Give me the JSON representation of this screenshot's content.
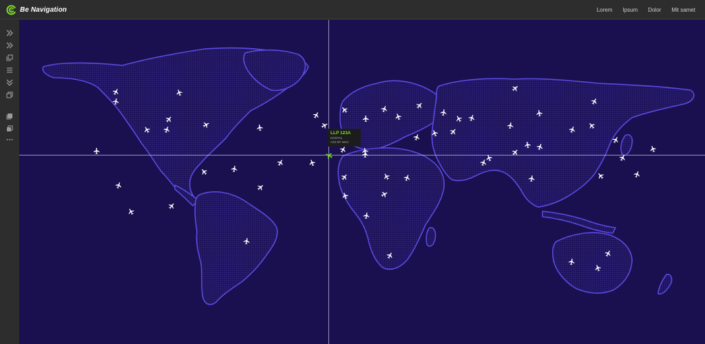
{
  "header": {
    "brand": "Be Navigation",
    "nav": [
      "Lorem",
      "Ipsum",
      "Dolor",
      "Mit samet"
    ]
  },
  "sidebar": {
    "icons": [
      "chevrons-right-icon",
      "chevrons-right-icon",
      "layers-icon",
      "menu-icon",
      "chevrons-down-icon",
      "copy-icon",
      "book-icon",
      "gallery-icon",
      "more-icon"
    ]
  },
  "tooltip": {
    "flight_id": "LLP 123A",
    "line1": "KOSTAL",
    "line2": "A33 SP-WAV"
  },
  "colors": {
    "accent": "#7ddc2a",
    "map_background": "#1a0f4f",
    "land_outline": "#5a4be0",
    "topbar": "#2d2d2d"
  }
}
